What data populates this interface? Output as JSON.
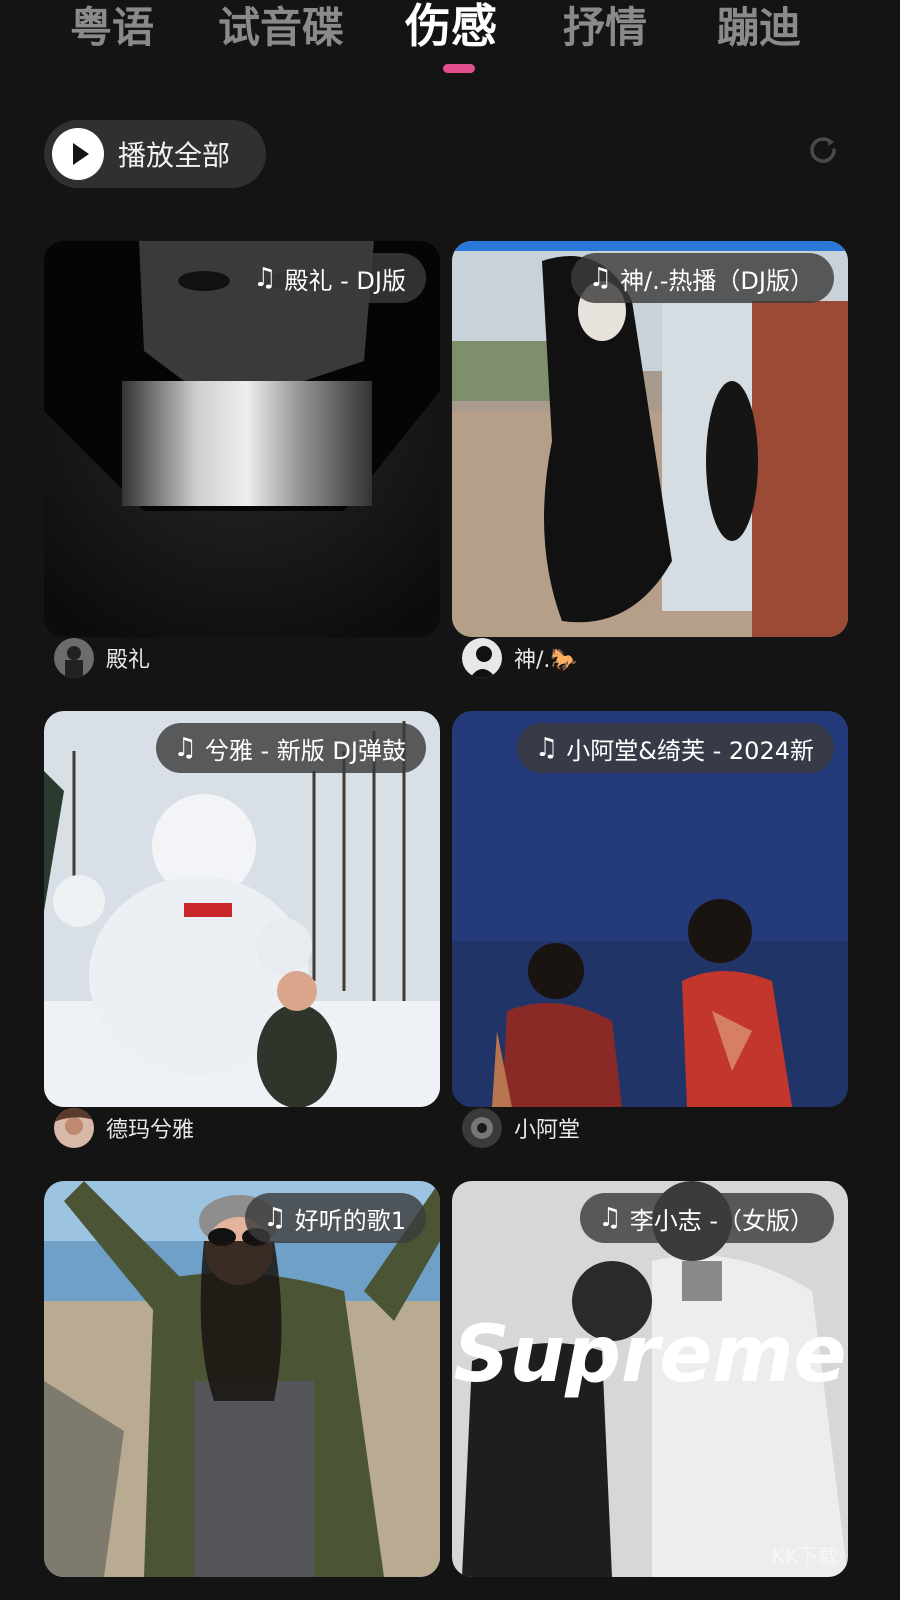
{
  "tabs": [
    "粤语",
    "试音碟",
    "伤感",
    "抒情",
    "蹦迪"
  ],
  "active_tab_index": 2,
  "colors": {
    "background": "#141414",
    "accent": "#e34f8c"
  },
  "toolbar": {
    "play_all_label": "播放全部",
    "play_icon": "play-icon",
    "refresh_icon": "refresh-icon"
  },
  "cards": [
    {
      "title": "殿礼 - DJ版",
      "author": "殿礼"
    },
    {
      "title": "神/.-热播（DJ版）",
      "author": "神/.🐎"
    },
    {
      "title": "兮雅 - 新版 DJ弹鼓",
      "author": "德玛兮雅"
    },
    {
      "title": "小阿堂&绮芙 - 2024新",
      "author": "小阿堂"
    },
    {
      "title": "好听的歌1",
      "author": ""
    },
    {
      "title": "李小志 -（女版）",
      "author": ""
    }
  ],
  "card5_art_text": "Supreme",
  "watermark": "KK下载"
}
